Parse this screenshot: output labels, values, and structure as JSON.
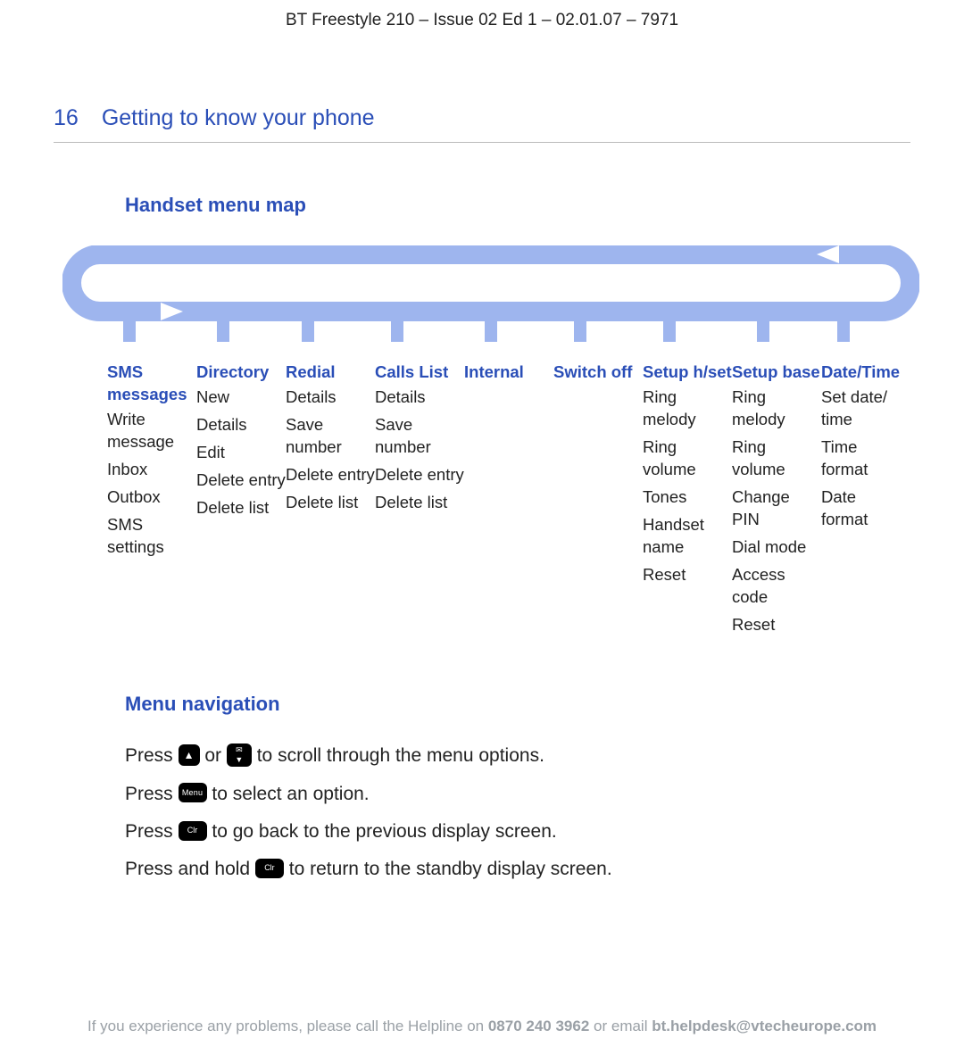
{
  "doc_header": "BT Freestyle 210 – Issue 02 Ed 1 – 02.01.07 – 7971",
  "page_number": "16",
  "page_title": "Getting to know your phone",
  "section_menu_map": "Handset menu map",
  "menus": {
    "sms": {
      "title": "SMS messages",
      "items": [
        "Write message",
        "Inbox",
        "Outbox",
        "SMS settings"
      ]
    },
    "directory": {
      "title": "Directory",
      "items": [
        "New",
        "Details",
        "Edit",
        "Delete entry",
        "Delete list"
      ]
    },
    "redial": {
      "title": "Redial",
      "items": [
        "Details",
        "Save number",
        "Delete entry",
        "Delete list"
      ]
    },
    "calls": {
      "title": "Calls List",
      "items": [
        "Details",
        "Save number",
        "Delete entry",
        "Delete list"
      ]
    },
    "internal": {
      "title": "Internal",
      "items": []
    },
    "switchoff": {
      "title": "Switch off",
      "items": []
    },
    "hset": {
      "title": "Setup h/set",
      "items": [
        "Ring melody",
        "Ring volume",
        "Tones",
        "Handset name",
        "Reset"
      ]
    },
    "base": {
      "title": "Setup base",
      "items": [
        "Ring melody",
        "Ring volume",
        "Change PIN",
        "Dial mode",
        "Access code",
        "Reset"
      ]
    },
    "datetime": {
      "title": "Date/Time",
      "items": [
        "Set date/ time",
        "Time format",
        "Date format"
      ]
    }
  },
  "section_nav": "Menu navigation",
  "nav": {
    "press": "Press ",
    "or": " or ",
    "scroll_suffix": " to scroll through the menu options.",
    "select_suffix": " to select an option.",
    "back_suffix": " to go back to the previous display screen.",
    "hold_prefix": "Press and hold ",
    "standby_suffix": " to return to the standby display screen.",
    "key_up": "▲",
    "key_sms": "✉",
    "key_down": "▼",
    "key_menu": "Menu",
    "key_clr": "Clr"
  },
  "footer": {
    "pre": "If you experience any problems, please call the Helpline on ",
    "phone": "0870 240 3962",
    "mid": " or email ",
    "email": "bt.helpdesk@vtecheurope.com"
  }
}
